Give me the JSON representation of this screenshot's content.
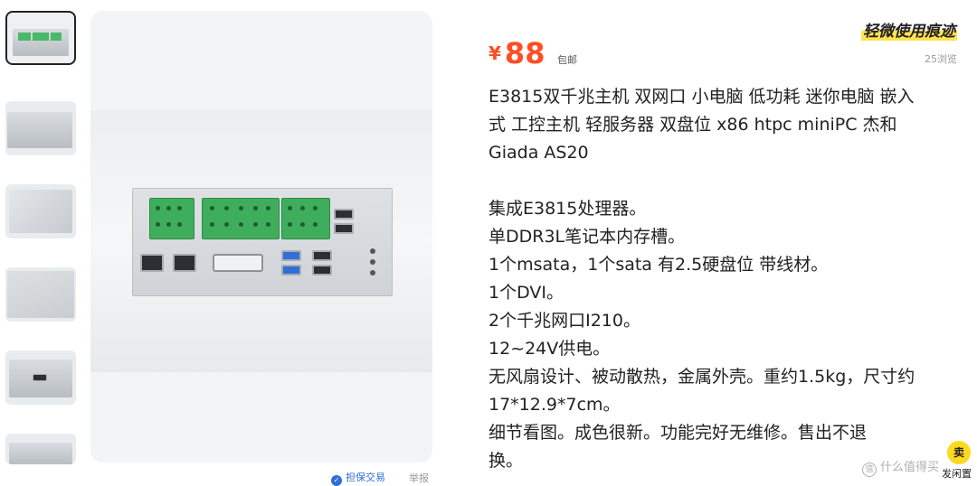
{
  "header": {
    "tag": "轻微使用痕迹",
    "price_currency": "¥",
    "price_value": "88",
    "shipping": "包邮",
    "views": "25浏览"
  },
  "description": {
    "title_lines": [
      "E3815双千兆主机 双网口 小电脑 低功耗 迷你电脑 嵌入",
      "式 工控主机 轻服务器 双盘位 x86 htpc miniPC 杰和",
      "Giada AS20"
    ],
    "spec_lines": [
      "集成E3815处理器。",
      "单DDR3L笔记本内存槽。",
      "1个msata，1个sata 有2.5硬盘位 带线材。",
      "1个DVI。",
      "2个千兆网口I210。",
      "12~24V供电。",
      "无风扇设计、被动散热，金属外壳。重约1.5kg，尺寸约",
      "17*12.9*7cm。",
      "细节看图。成色很新。功能完好无维修。售出不退",
      "换。"
    ]
  },
  "footer": {
    "guarantee_icon": "shield-icon",
    "guarantee_label": "担保交易",
    "report_label": "举报",
    "sell_badge": "卖",
    "sell_label": "发闲置",
    "watermark": "什么值得买"
  },
  "colors": {
    "price": "#ff4d24",
    "highlight": "#ffe34f",
    "link": "#2f6fd6",
    "sell_badge": "#ffd820",
    "terminal_green": "#3fae5c"
  }
}
